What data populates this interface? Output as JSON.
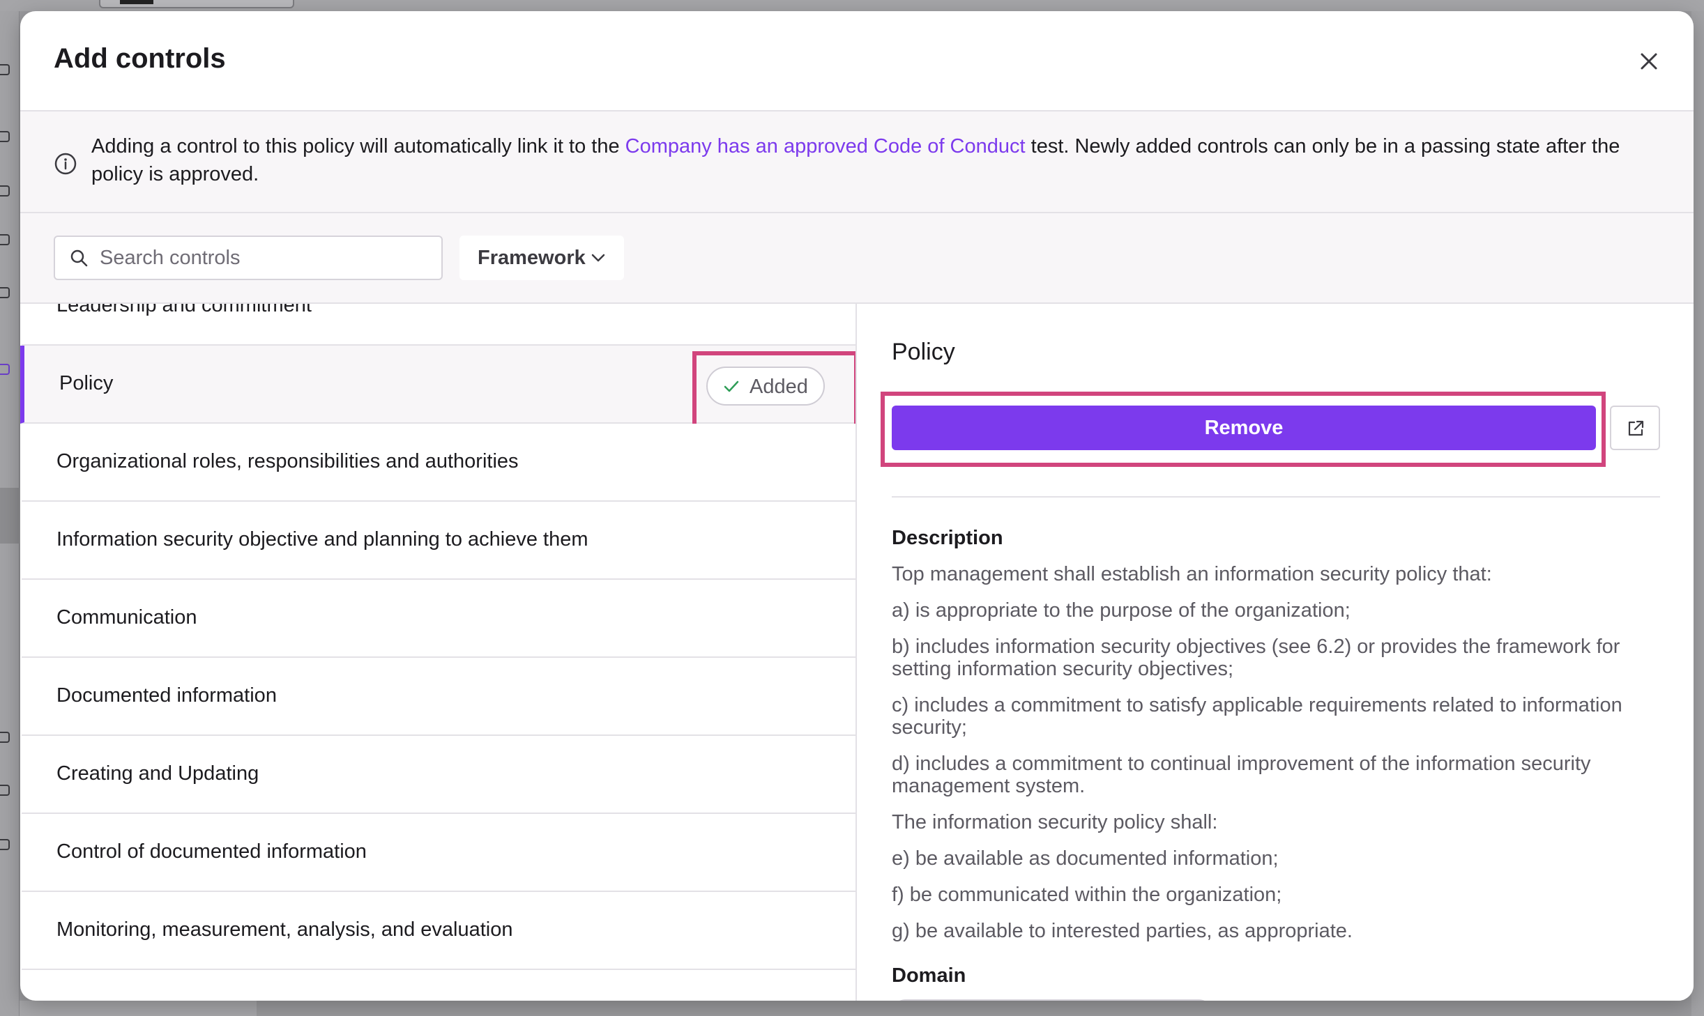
{
  "modal": {
    "title": "Add controls"
  },
  "banner": {
    "text_before": "Adding a control to this policy will automatically link it to the ",
    "link_text": "Company has an approved Code of Conduct",
    "text_after": " test. Newly added controls can only be in a passing state after the policy is approved."
  },
  "toolbar": {
    "search_placeholder": "Search controls",
    "framework_label": "Framework"
  },
  "list": {
    "items": [
      {
        "label": "Leadership and commitment",
        "selected": false
      },
      {
        "label": "Policy",
        "selected": true,
        "status": "Added"
      },
      {
        "label": "Organizational roles, responsibilities and authorities",
        "selected": false
      },
      {
        "label": "Information security objective and planning to achieve them",
        "selected": false
      },
      {
        "label": "Communication",
        "selected": false
      },
      {
        "label": "Documented information",
        "selected": false
      },
      {
        "label": "Creating and Updating",
        "selected": false
      },
      {
        "label": "Control of documented information",
        "selected": false
      },
      {
        "label": "Monitoring, measurement, analysis, and evaluation",
        "selected": false
      }
    ]
  },
  "detail": {
    "title": "Policy",
    "remove_label": "Remove",
    "description_heading": "Description",
    "description_lines": [
      "Top management shall establish an information security policy that:",
      "a) is appropriate to the purpose of the organization;",
      "b) includes information security objectives (see 6.2) or provides the framework for setting information security objectives;",
      "c) includes a commitment to satisfy applicable requirements related to information security;",
      "d) includes a commitment to continual improvement of the information security management system.",
      "The information security policy shall:",
      "e) be available as documented information;",
      "f) be communicated within the organization;",
      "g) be available to interested parties, as appropriate."
    ],
    "domain_heading": "Domain"
  },
  "colors": {
    "accent": "#7c3aed",
    "highlight": "#d1457d",
    "success": "#2e9d57"
  },
  "icons": {
    "close": "close-icon",
    "info": "info-icon",
    "search": "search-icon",
    "chevron": "chevron-down-icon",
    "check": "check-icon",
    "external": "external-link-icon"
  }
}
